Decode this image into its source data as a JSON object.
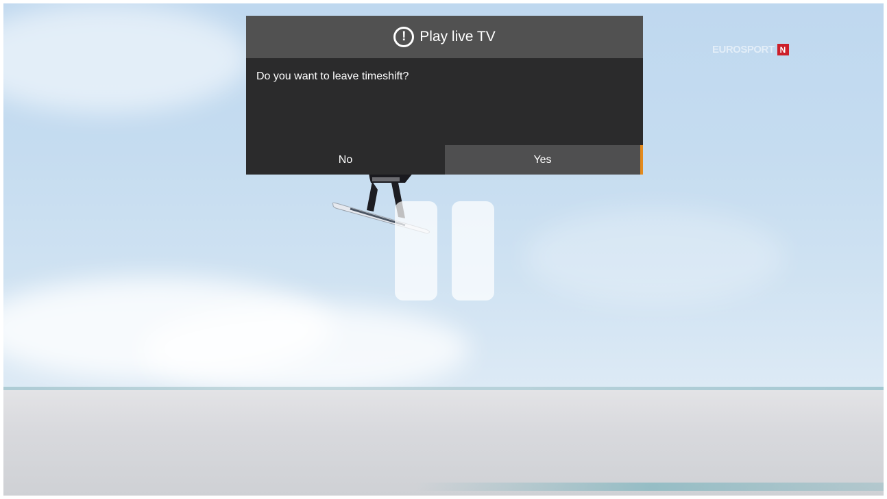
{
  "dialog": {
    "title": "Play live TV",
    "icon": "alert-circle-icon",
    "message": "Do you want to leave timeshift?",
    "buttons": {
      "no": "No",
      "yes": "Yes"
    },
    "focused_button": "yes",
    "accent_color": "#e38a1d"
  },
  "player": {
    "state": "paused",
    "pause_icon": "pause-icon"
  },
  "channel": {
    "name": "EUROSPORT",
    "badge": "N",
    "badge_color": "#cc1f2a"
  }
}
